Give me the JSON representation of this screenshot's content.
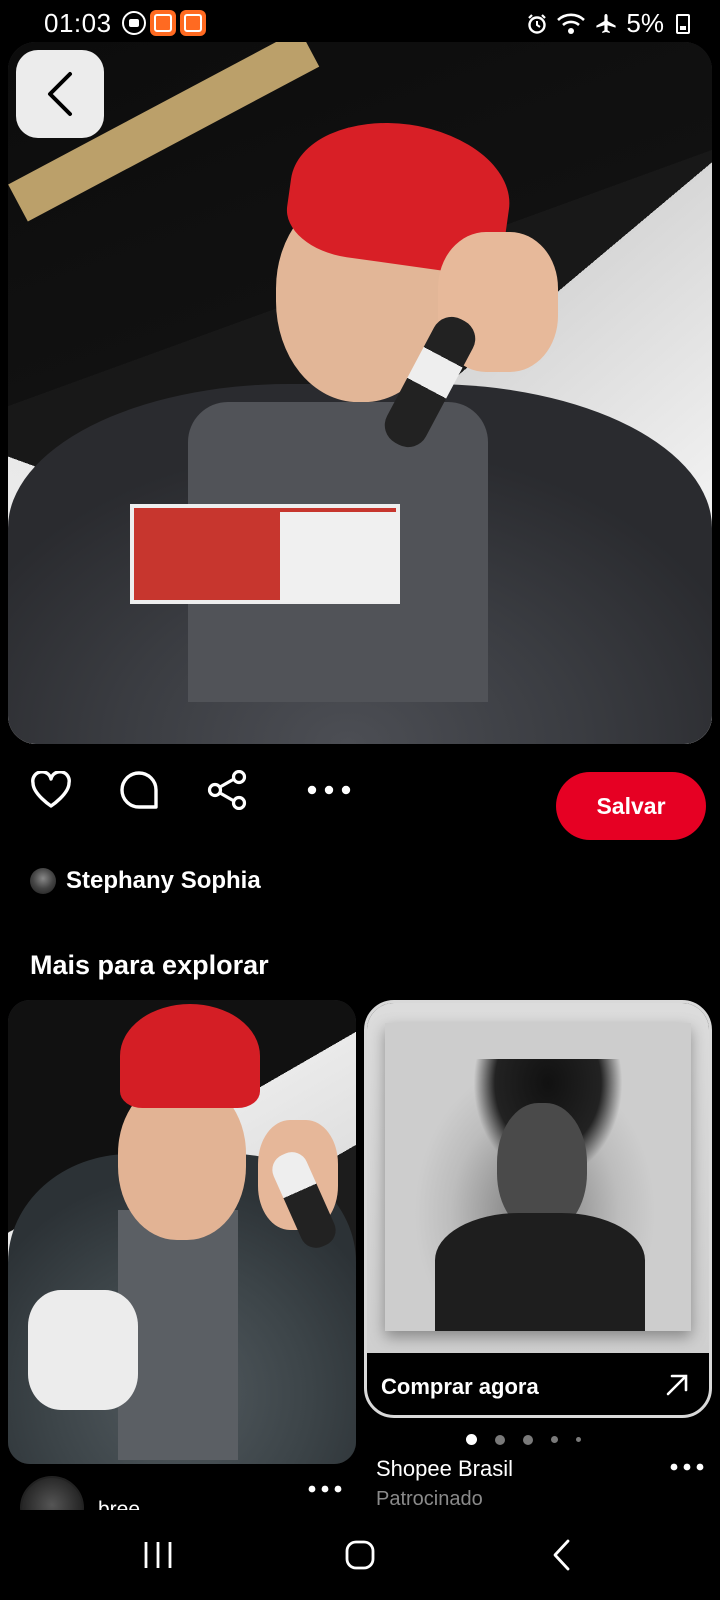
{
  "status_bar": {
    "time": "01:03",
    "battery": "5%"
  },
  "pin": {
    "back_label": "",
    "save_label": "Salvar",
    "author_name": "Stephany Sophia"
  },
  "explore": {
    "title": "Mais para explorar",
    "left_card": {
      "user_name": "bree"
    },
    "right_card": {
      "cta_label": "Comprar agora",
      "advertiser": "Shopee Brasil",
      "sponsored_label": "Patrocinado",
      "carousel_index": 0,
      "carousel_count": 5
    }
  },
  "icons": {
    "back": "chevron-left-icon",
    "like": "heart-icon",
    "comment": "comment-bubble-icon",
    "share": "share-icon",
    "more": "more-horizontal-icon",
    "external": "arrow-up-right-icon"
  },
  "colors": {
    "accent": "#e60023",
    "background": "#000000"
  }
}
